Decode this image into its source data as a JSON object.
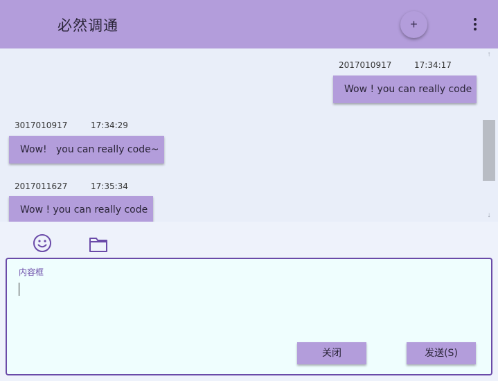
{
  "header": {
    "title": "必然调通",
    "add_icon": "plus-icon",
    "more_icon": "more-vert-icon",
    "add_glyph": "+"
  },
  "messages": [
    {
      "sender": "2017010917",
      "time": "17:34:17",
      "text": "Wow ! you can really code",
      "side": "right"
    },
    {
      "sender": "3017010917",
      "time": "17:34:29",
      "text": "Wow!   you can really code~",
      "side": "left"
    },
    {
      "sender": "2017011627",
      "time": "17:35:34",
      "text": "Wow ! you can really code",
      "side": "left"
    }
  ],
  "toolbar": {
    "emoji_icon": "smiley-icon",
    "file_icon": "folder-icon"
  },
  "editor": {
    "label": "内容框",
    "value": "",
    "close_label": "关闭",
    "send_label": "发送(S)"
  },
  "scrollbar": {
    "up_glyph": "↑",
    "down_glyph": "↓"
  },
  "colors": {
    "accent": "#b39ddb",
    "border": "#6a4aa8",
    "background": "#e9eef9",
    "editor_bg": "#effefe"
  }
}
